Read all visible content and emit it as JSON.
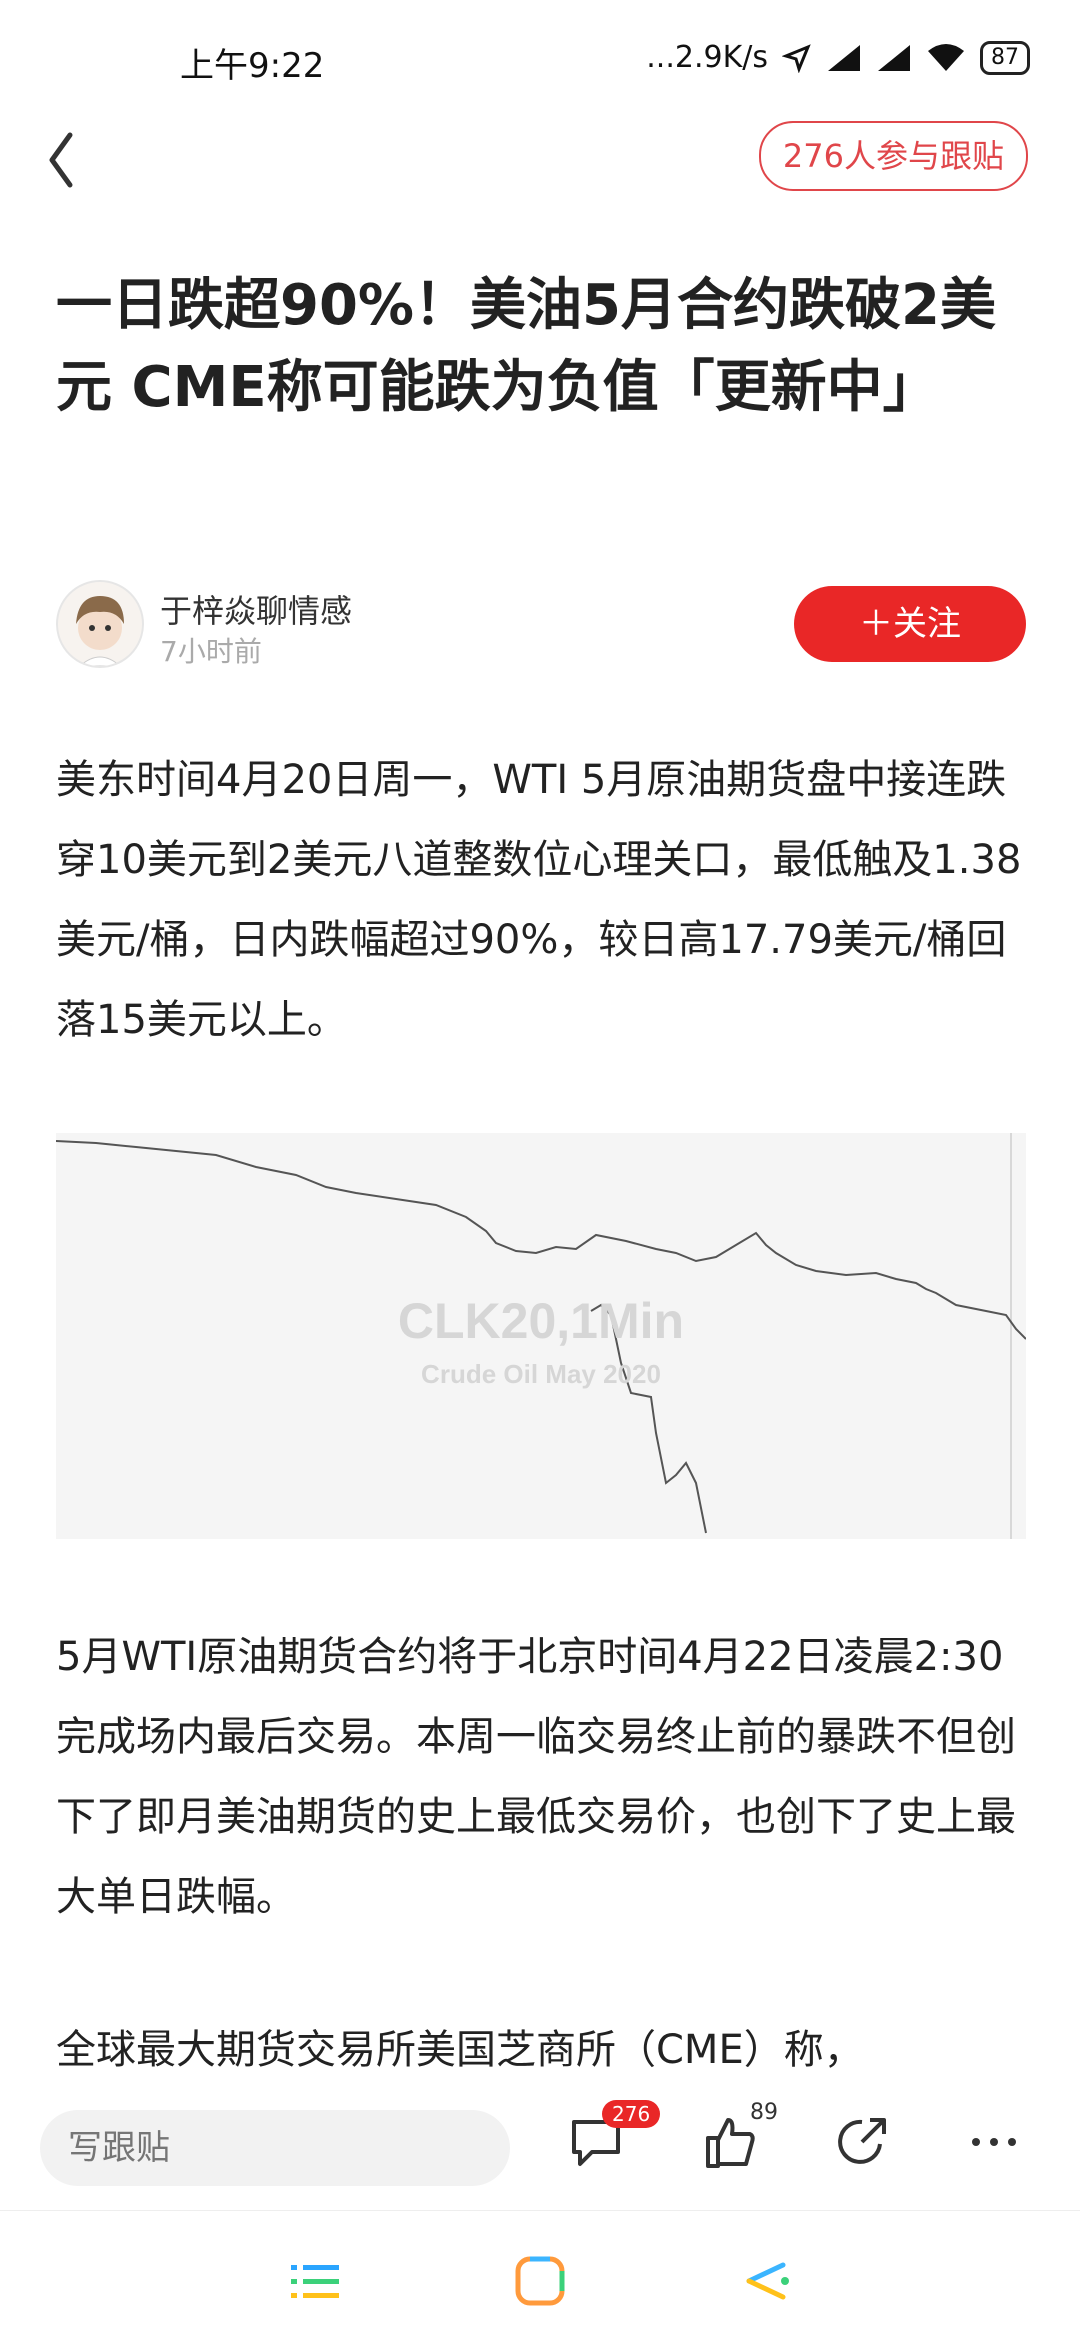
{
  "status_bar": {
    "time": "上午9:22",
    "network_speed": "...2.9K/s",
    "battery": "87"
  },
  "nav": {
    "comments_pill": "276人参与跟贴"
  },
  "article": {
    "title": "一日跌超90%！美油5月合约跌破2美元 CME称可能跌为负值「更新中」",
    "author": {
      "name": "于梓焱聊情感",
      "time": "7小时前",
      "follow_label": "＋关注"
    },
    "paragraphs": [
      "美东时间4月20日周一，WTI 5月原油期货盘中接连跌穿10美元到2美元八道整数位心理关口，最低触及1.38美元/桶，日内跌幅超过90%，较日高17.79美元/桶回落15美元以上。",
      "5月WTI原油期货合约将于北京时间4月22日凌晨2:30完成场内最后交易。本周一临交易终止前的暴跌不但创下了即月美油期货的史上最低交易价，也创下了史上最大单日跌幅。",
      "全球最大期货交易所美国芝商所（CME）称，"
    ],
    "image": {
      "watermark_title": "CLK20,1Min",
      "watermark_subtitle": "Crude Oil May 2020"
    }
  },
  "bottom_bar": {
    "reply_placeholder": "写跟贴",
    "comment_count": "276",
    "like_count": "89"
  },
  "colors": {
    "accent_red": "#e92727",
    "pill_red": "#e0464a"
  },
  "icons": [
    "back-icon",
    "comment-icon",
    "like-icon",
    "share-icon",
    "more-icon",
    "menu-icon",
    "home-icon",
    "back-nav-icon"
  ]
}
